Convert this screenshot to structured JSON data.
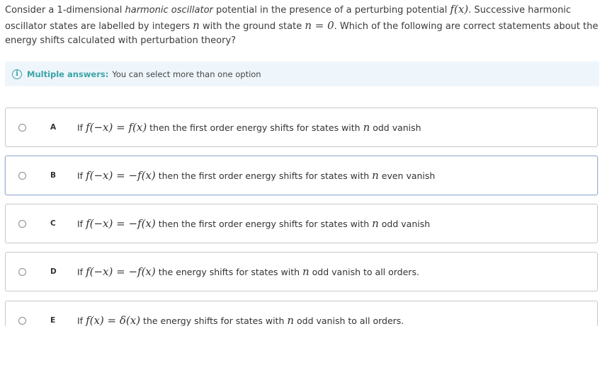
{
  "question": {
    "part1": "Consider a 1-dimensional ",
    "part2": "harmonic oscillator",
    "part3": " potential in the presence of a perturbing potential ",
    "math_f": "f(x)",
    "part4": ". Successive harmonic oscillator states are labelled by integers ",
    "math_n": "n",
    "part5": " with the ground state ",
    "math_n0": "n = 0",
    "part6": ". Which of the following are correct statements about the energy shifts calculated with perturbation theory?"
  },
  "hint": {
    "icon": "info-icon",
    "bold": "Multiple answers:",
    "text": "You can select more than one option"
  },
  "options": [
    {
      "letter": "A",
      "prefix": "If ",
      "math": "f(−x) = f(x)",
      "suffix": " then the first order energy shifts for states with ",
      "math2": "n",
      "suffix2": " odd vanish"
    },
    {
      "letter": "B",
      "prefix": "If ",
      "math": "f(−x) = −f(x)",
      "suffix": " then the first order energy shifts for states with ",
      "math2": "n",
      "suffix2": " even vanish"
    },
    {
      "letter": "C",
      "prefix": "If ",
      "math": "f(−x) = −f(x)",
      "suffix": " then the first order energy shifts for states with ",
      "math2": "n",
      "suffix2": " odd vanish"
    },
    {
      "letter": "D",
      "prefix": "If ",
      "math": "f(−x) = −f(x)",
      "suffix": " the energy shifts for states with ",
      "math2": "n",
      "suffix2": " odd vanish to all orders."
    },
    {
      "letter": "E",
      "prefix": "If ",
      "math": "f(x) = δ(x)",
      "suffix": " the energy shifts for states with ",
      "math2": "n",
      "suffix2": " odd vanish to all orders."
    }
  ]
}
